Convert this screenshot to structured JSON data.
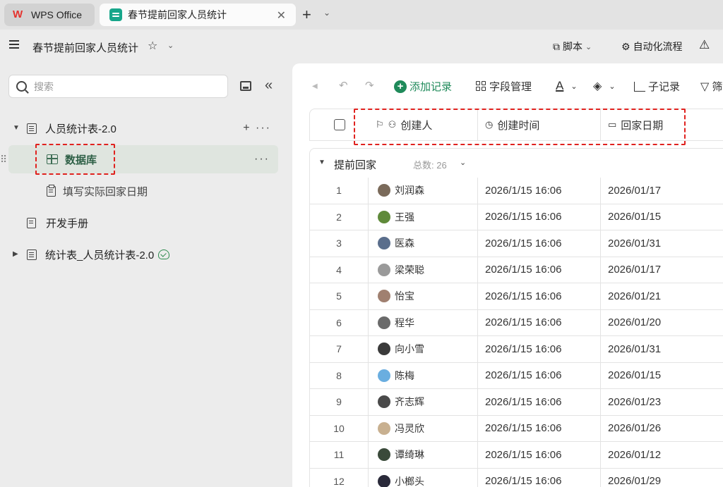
{
  "tabs": {
    "home_label": "WPS Office",
    "doc_label": "春节提前回家人员统计"
  },
  "header": {
    "title": "春节提前回家人员统计",
    "script_label": "脚本",
    "automation_label": "自动化流程"
  },
  "sidebar": {
    "search_placeholder": "搜索",
    "items": [
      {
        "label": "人员统计表-2.0"
      },
      {
        "label": "数据库"
      },
      {
        "label": "填写实际回家日期"
      },
      {
        "label": "开发手册"
      },
      {
        "label": "统计表_人员统计表-2.0"
      }
    ]
  },
  "toolbar": {
    "add_record": "添加记录",
    "field_manage": "字段管理",
    "font_label": "A",
    "sub_record": "子记录",
    "filter_label": "筛"
  },
  "table": {
    "columns": [
      "创建人",
      "创建时间",
      "回家日期"
    ],
    "group": {
      "name": "提前回家",
      "count_label": "总数:",
      "count": "26"
    },
    "rows": [
      {
        "idx": "1",
        "user": "刘润森",
        "created": "2026/1/15 16:06",
        "date": "2026/01/17",
        "avatar_color": "#7a6a5a"
      },
      {
        "idx": "2",
        "user": "王强",
        "created": "2026/1/15 16:06",
        "date": "2026/01/15",
        "avatar_color": "#5f8a3a"
      },
      {
        "idx": "3",
        "user": "医森",
        "created": "2026/1/15 16:06",
        "date": "2026/01/31",
        "avatar_color": "#5a6e8c"
      },
      {
        "idx": "4",
        "user": "梁荣聪",
        "created": "2026/1/15 16:06",
        "date": "2026/01/17",
        "avatar_color": "#9a9a9a"
      },
      {
        "idx": "5",
        "user": "怡宝",
        "created": "2026/1/15 16:06",
        "date": "2026/01/21",
        "avatar_color": "#a08070"
      },
      {
        "idx": "6",
        "user": "程华",
        "created": "2026/1/15 16:06",
        "date": "2026/01/20",
        "avatar_color": "#6a6a6a"
      },
      {
        "idx": "7",
        "user": "向小雪",
        "created": "2026/1/15 16:06",
        "date": "2026/01/31",
        "avatar_color": "#3a3a3a"
      },
      {
        "idx": "8",
        "user": "陈梅",
        "created": "2026/1/15 16:06",
        "date": "2026/01/15",
        "avatar_color": "#6aaee0"
      },
      {
        "idx": "9",
        "user": "齐志辉",
        "created": "2026/1/15 16:06",
        "date": "2026/01/23",
        "avatar_color": "#4a4a4a"
      },
      {
        "idx": "10",
        "user": "冯灵欣",
        "created": "2026/1/15 16:06",
        "date": "2026/01/26",
        "avatar_color": "#c8b090"
      },
      {
        "idx": "11",
        "user": "谭绮琳",
        "created": "2026/1/15 16:06",
        "date": "2026/01/12",
        "avatar_color": "#3a4a3a"
      },
      {
        "idx": "12",
        "user": "小榔头",
        "created": "2026/1/15 16:06",
        "date": "2026/01/29",
        "avatar_color": "#2a2a3a"
      }
    ]
  },
  "colors": {
    "accent": "#1f8a5a",
    "highlight_box": "#e0221f",
    "selected_bg": "#dfe5df"
  }
}
